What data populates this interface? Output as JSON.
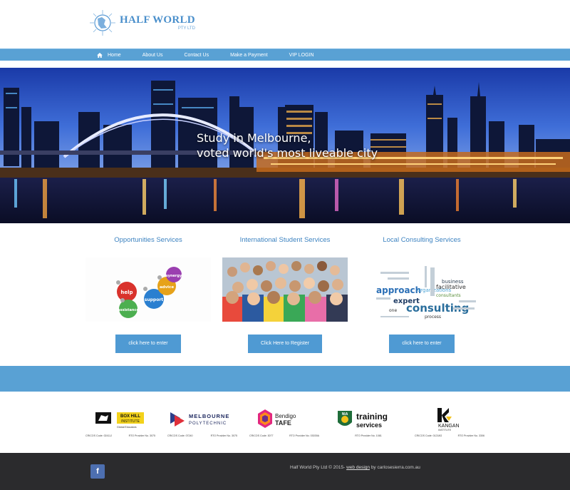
{
  "header": {
    "logo_title": "HALF WORLD",
    "logo_sub": "PTY LTD"
  },
  "nav": {
    "items": [
      {
        "label": "Home",
        "icon": "home-icon"
      },
      {
        "label": "About Us"
      },
      {
        "label": "Contact Us"
      },
      {
        "label": "Make a Payment"
      },
      {
        "label": "VIP LOGIN"
      }
    ]
  },
  "hero": {
    "line1": "Study in Melbourne,",
    "line2": "voted world's most liveable city"
  },
  "services": [
    {
      "title": "Opportunities Services",
      "button": "click here to enter",
      "words": [
        "synergy",
        "help",
        "advice",
        "support",
        "assistance"
      ]
    },
    {
      "title": "International Student Services",
      "button": "Click Here to Register"
    },
    {
      "title": "Local Consulting Services",
      "button": "click here to enter",
      "words": [
        "approach",
        "organizations",
        "business",
        "facilitative",
        "expert",
        "consultants",
        "consulting",
        "one",
        "process"
      ]
    }
  ],
  "partners": [
    {
      "name_line1": "BOX HILL",
      "name_line2": "INSTITUTE",
      "tag": "Global Educators",
      "code_left": "CRICOS Code: 02411J",
      "code_right": "RTO Provider No. 3075"
    },
    {
      "name_line1": "MELBOURNE",
      "name_line2": "POLYTECHNIC",
      "code_left": "CRICOS Code: 07240",
      "code_right": "RTO Provider No. 3075"
    },
    {
      "name_line1": "Bendigo",
      "name_line2": "TAFE",
      "code_left": "CRICOS Code: 3077",
      "code_right": "RTO Provider No. 03039A"
    },
    {
      "name_line1": "training",
      "name_line2": "services",
      "badge": "NIA",
      "code_left": "",
      "code_right": "RTO Provider No. 1081"
    },
    {
      "name_line1": "KANGAN",
      "name_line2": "INSTITUTE",
      "code_left": "CRICOS Code: 01218G",
      "code_right": "RTO Provider No. 3306"
    }
  ],
  "footer": {
    "fb_label": "f",
    "copyright": "Half World Pty Ltd © 2015-",
    "link": "web design",
    "by": "by carlosesierra.com.au"
  },
  "colors": {
    "accent": "#59a1d4",
    "button": "#4f9ad3",
    "title_blue": "#3d83c1",
    "footer_bg": "#2b2b2d"
  }
}
